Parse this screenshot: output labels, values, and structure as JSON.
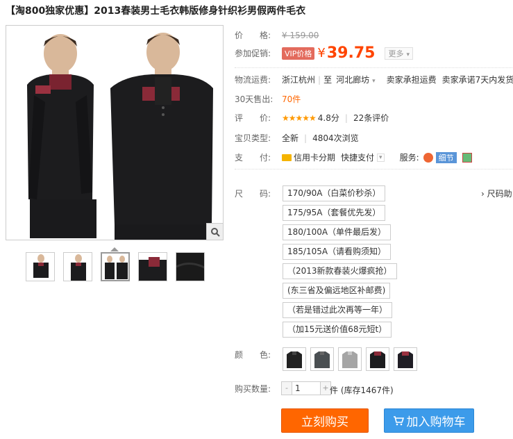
{
  "title": "【淘800独家优惠】2013春装男士毛衣韩版修身针织衫男假两件毛衣",
  "price": {
    "label": "价　　格:",
    "original": "¥ 159.00"
  },
  "promo": {
    "label": "参加促销:",
    "badge": "VIP价格",
    "yen": "¥",
    "amount": "39.75",
    "more": "更多"
  },
  "shipping": {
    "label": "物流运费:",
    "from": "浙江杭州",
    "to_prefix": "至",
    "to": "河北廊坊",
    "fee": "卖家承担运费",
    "promise": "卖家承诺7天内发货"
  },
  "sales": {
    "label": "30天售出:",
    "count": "70件"
  },
  "rating": {
    "label": "评　　价:",
    "stars": "★★★★★",
    "score": "4.8分",
    "reviews": "22条评价"
  },
  "item_type": {
    "label": "宝贝类型:",
    "condition": "全新",
    "views": "4804次浏览"
  },
  "payment": {
    "label": "支　　付:",
    "credit": "信用卡分期",
    "quick": "快捷支付",
    "service_label": "服务:",
    "detail": "细节"
  },
  "size": {
    "label": "尺　　码:",
    "guide": "尺码助",
    "options": [
      "170/90A（白菜价秒杀）",
      "175/95A（套餐优先发）",
      "180/100A（单件最后发）",
      "185/105A（请看购须知）",
      "（2013新款春装火爆疯抢）",
      "(东三省及偏远地区补邮费)",
      "（若是错过此次再等一年）",
      "（加15元送价值68元短t）"
    ]
  },
  "color": {
    "label": "颜　　色:"
  },
  "quantity": {
    "label": "购买数量:",
    "value": "1",
    "minus": "-",
    "plus": "+",
    "stock": "件 (库存1467件)"
  },
  "buttons": {
    "buy": "立刻购买",
    "cart": "加入购物车"
  },
  "icons": {
    "zoom": "magnifier-icon",
    "cart": "cart-icon",
    "star": "star-icon"
  }
}
